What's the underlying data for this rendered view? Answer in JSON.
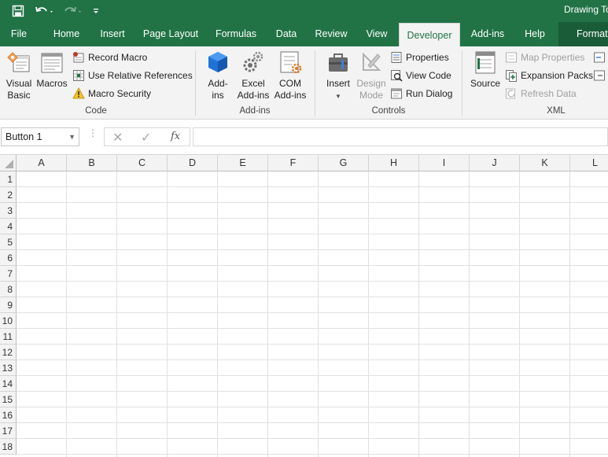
{
  "window": {
    "title": "Drawing To",
    "accent": "#217346",
    "qat": {
      "save_icon": "save-icon",
      "undo_icon": "undo-icon",
      "redo_icon": "redo-icon",
      "customize_icon": "customize-qat-icon"
    }
  },
  "tabs": {
    "file": "File",
    "home": "Home",
    "insert": "Insert",
    "page_layout": "Page Layout",
    "formulas": "Formulas",
    "data": "Data",
    "review": "Review",
    "view": "View",
    "developer": "Developer",
    "addins": "Add-ins",
    "help": "Help",
    "format": "Format",
    "active": "Developer"
  },
  "ribbon": {
    "code": {
      "label": "Code",
      "visual_basic_1": "Visual",
      "visual_basic_2": "Basic",
      "macros": "Macros",
      "record_macro": "Record Macro",
      "relative_refs": "Use Relative References",
      "macro_security": "Macro Security"
    },
    "addins": {
      "label": "Add-ins",
      "addins_1": "Add-",
      "addins_2": "ins",
      "excel_addins_1": "Excel",
      "excel_addins_2": "Add-ins",
      "com_addins_1": "COM",
      "com_addins_2": "Add-ins"
    },
    "controls": {
      "label": "Controls",
      "insert": "Insert",
      "design_mode_1": "Design",
      "design_mode_2": "Mode",
      "properties": "Properties",
      "view_code": "View Code",
      "run_dialog": "Run Dialog"
    },
    "xml": {
      "label": "XML",
      "source": "Source",
      "map_properties": "Map Properties",
      "expansion_packs": "Expansion Packs",
      "refresh_data": "Refresh Data"
    }
  },
  "formula_bar": {
    "name_box": "Button 1",
    "formula": "",
    "fx": "fx"
  },
  "sheet": {
    "columns": [
      "A",
      "B",
      "C",
      "D",
      "E",
      "F",
      "G",
      "H",
      "I",
      "J",
      "K",
      "L"
    ],
    "rows": [
      "1",
      "2",
      "3",
      "4",
      "5",
      "6",
      "7",
      "8",
      "9",
      "10",
      "11",
      "12",
      "13",
      "14",
      "15",
      "16",
      "17",
      "18"
    ]
  }
}
